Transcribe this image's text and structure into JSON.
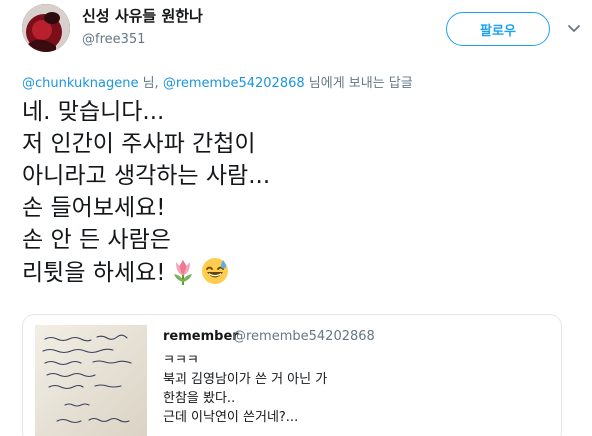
{
  "author": {
    "display_name": "신성 사유들 원한나",
    "handle": "@free351"
  },
  "follow_button": {
    "label": "팔로우"
  },
  "reply_context": {
    "mention_1": "@chunkuknagene",
    "sep_1": " 님, ",
    "mention_2": "@remembe54202868",
    "suffix": " 님에게 보내는 답글"
  },
  "tweet": {
    "lines": [
      "네. 맞습니다...",
      "저 인간이 주사파 간첩이",
      "아니라고 생각하는 사람...",
      "손 들어보세요!",
      "손 안 든 사람은",
      "리튓을 하세요!"
    ],
    "emojis": [
      "tulip-emoji",
      "grinning-sweat-emoji"
    ]
  },
  "quoted_tweet": {
    "name": "remember",
    "handle": "@remembe54202868",
    "lines": [
      "ㅋㅋㅋ",
      "북괴 김영남이가 쓴 거 아닌 가",
      "한참을 봤다..",
      "근데 이낙연이 쓴거네?..."
    ]
  },
  "colors": {
    "accent": "#1da1f2",
    "mention": "#1b95e0",
    "muted": "#657786",
    "text": "#14171a",
    "border": "#e1e8ed"
  }
}
